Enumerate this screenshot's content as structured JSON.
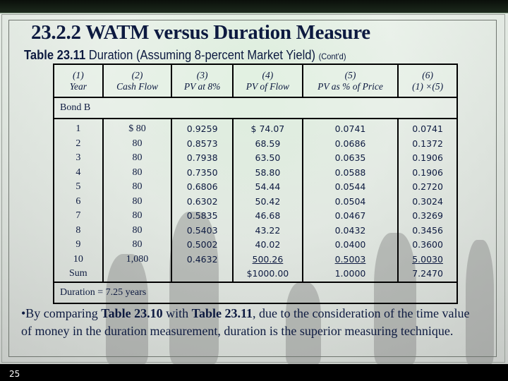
{
  "slide": {
    "title": "23.2.2 WATM versus Duration Measure",
    "subtitle_bold": "Table 23.11",
    "subtitle_text": " Duration (Assuming 8-percent Market Yield) ",
    "subtitle_small": "(Cont'd)",
    "page_number": "25"
  },
  "table": {
    "headers": [
      {
        "num": "(1)",
        "label": "Year"
      },
      {
        "num": "(2)",
        "label": "Cash Flow"
      },
      {
        "num": "(3)",
        "label": "PV at 8%"
      },
      {
        "num": "(4)",
        "label": "PV of Flow"
      },
      {
        "num": "(5)",
        "label": "PV as % of Price"
      },
      {
        "num": "(6)",
        "label": "(1) ×(5)"
      }
    ],
    "section_label": "Bond B",
    "columns": {
      "year": [
        "1",
        "2",
        "3",
        "4",
        "5",
        "6",
        "7",
        "8",
        "9",
        "10",
        "Sum"
      ],
      "cash_flow": [
        "$  80",
        "80",
        "80",
        "80",
        "80",
        "80",
        "80",
        "80",
        "80",
        "1,080"
      ],
      "pv_factor": [
        "0.9259",
        "0.8573",
        "0.7938",
        "0.7350",
        "0.6806",
        "0.6302",
        "0.5835",
        "0.5403",
        "0.5002",
        "0.4632"
      ],
      "pv_of_flow": [
        "$ 74.07",
        "68.59",
        "63.50",
        "58.80",
        "54.44",
        "50.42",
        "46.68",
        "43.22",
        "40.02",
        "500.26",
        "$1000.00"
      ],
      "pv_pct_price": [
        "0.0741",
        "0.0686",
        "0.0635",
        "0.0588",
        "0.0544",
        "0.0504",
        "0.0467",
        "0.0432",
        "0.0400",
        "0.5003",
        "1.0000"
      ],
      "weighted": [
        "0.0741",
        "0.1372",
        "0.1906",
        "0.1906",
        "0.2720",
        "0.3024",
        "0.3269",
        "0.3456",
        "0.3600",
        "5.0030",
        "7.2470"
      ]
    },
    "footer": "Duration = 7.25 years"
  },
  "bullet": {
    "prefix": "•By comparing ",
    "bold1": "Table 23.10",
    "mid": " with ",
    "bold2": "Table 23.11",
    "suffix": ", due to the consideration of the time value of money in the duration measurement, duration is the superior measuring technique."
  }
}
